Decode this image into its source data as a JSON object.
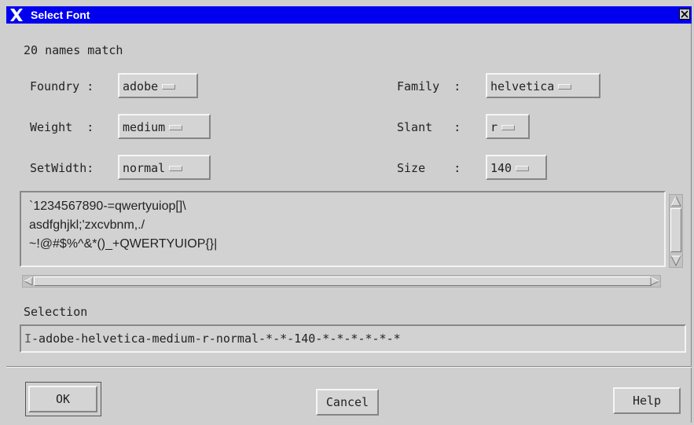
{
  "window": {
    "title": "Select Font",
    "logo_icon": "x-logo-icon",
    "close_icon": "close-icon"
  },
  "status": {
    "match_text": "20 names match"
  },
  "fields": {
    "foundry": {
      "label": "Foundry :",
      "value": "adobe"
    },
    "family": {
      "label": "Family  :",
      "value": "helvetica"
    },
    "weight": {
      "label": "Weight  :",
      "value": "medium"
    },
    "slant": {
      "label": "Slant   :",
      "value": "r"
    },
    "setwidth": {
      "label": "SetWidth:",
      "value": "normal"
    },
    "size": {
      "label": "Size    :",
      "value": "140"
    }
  },
  "preview": {
    "lines": [
      "`1234567890-=qwertyuiop[]\\",
      "asdfghjkl;'zxcvbnm,./",
      "~!@#$%^&*()_+QWERTYUIOP{}|"
    ]
  },
  "selection": {
    "label": "Selection",
    "value": "-adobe-helvetica-medium-r-normal-*-*-140-*-*-*-*-*-*"
  },
  "buttons": {
    "ok": "OK",
    "cancel": "Cancel",
    "help": "Help"
  },
  "colors": {
    "titlebar": "#0000ee",
    "background": "#cfcfcf"
  }
}
